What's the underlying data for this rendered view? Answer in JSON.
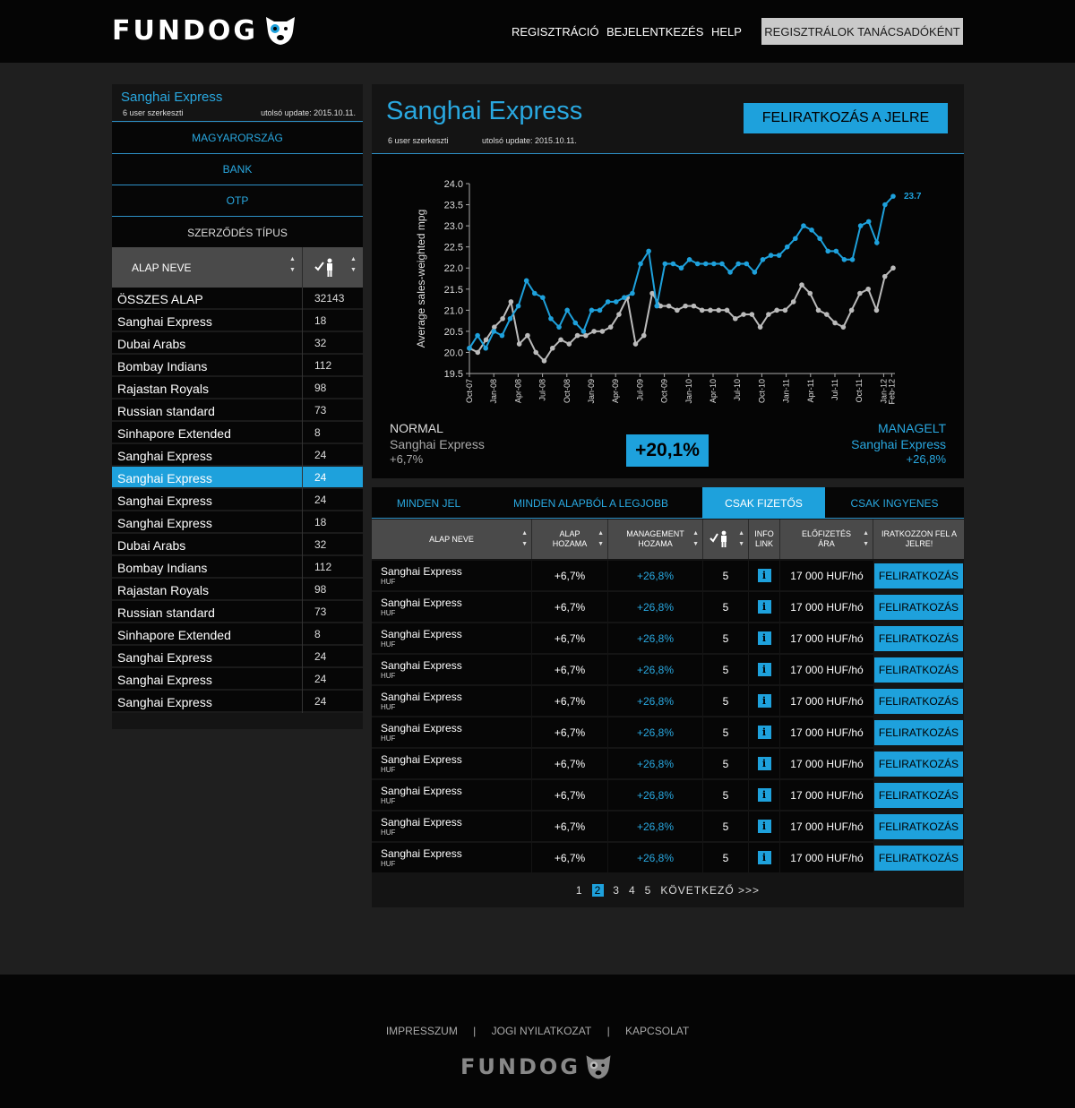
{
  "header": {
    "logo": "FUNDOG",
    "nav": [
      "REGISZTRÁCIÓ",
      "BEJELENTKEZÉS",
      "HELP"
    ],
    "advisor_button": "REGISZTRÁLOK TANÁCSADÓKÉNT"
  },
  "left": {
    "title": "Sanghai Express",
    "users": "6 user szerkeszti",
    "update": "utolsó update: 2015.10.11.",
    "filters": [
      "MAGYARORSZÁG",
      "BANK",
      "OTP",
      "SZERZŐDÉS TÍPUS"
    ],
    "col_name": "ALAP NEVE",
    "rows": [
      {
        "name": "ÖSSZES ALAP",
        "count": "32143"
      },
      {
        "name": "Sanghai Express",
        "count": "18"
      },
      {
        "name": "Dubai Arabs",
        "count": "32"
      },
      {
        "name": "Bombay Indians",
        "count": "112"
      },
      {
        "name": "Rajastan Royals",
        "count": "98"
      },
      {
        "name": "Russian standard",
        "count": "73"
      },
      {
        "name": "Sinhapore Extended",
        "count": "8"
      },
      {
        "name": "Sanghai Express",
        "count": "24"
      },
      {
        "name": "Sanghai Express",
        "count": "24"
      },
      {
        "name": "Sanghai Express",
        "count": "24"
      },
      {
        "name": "Sanghai Express",
        "count": "18"
      },
      {
        "name": "Dubai Arabs",
        "count": "32"
      },
      {
        "name": "Bombay Indians",
        "count": "112"
      },
      {
        "name": "Rajastan Royals",
        "count": "98"
      },
      {
        "name": "Russian standard",
        "count": "73"
      },
      {
        "name": "Sinhapore Extended",
        "count": "8"
      },
      {
        "name": "Sanghai Express",
        "count": "24"
      },
      {
        "name": "Sanghai Express",
        "count": "24"
      },
      {
        "name": "Sanghai Express",
        "count": "24"
      }
    ],
    "active_row": 8
  },
  "detail": {
    "title": "Sanghai Express",
    "users": "6 user szerkeszti",
    "update": "utolsó update: 2015.10.11.",
    "subscribe": "FELIRATKOZÁS A JELRE",
    "normal_label": "NORMAL",
    "normal_name": "Sanghai Express",
    "normal_value": "+6,7%",
    "diff": "+20,1%",
    "managed_label": "MANAGELT",
    "managed_name": "Sanghai Express",
    "managed_value": "+26,8%"
  },
  "chart_data": {
    "type": "line",
    "ylabel": "Average sales-weighted mpg",
    "ylim": [
      19.5,
      24.0
    ],
    "yticks": [
      "19.5",
      "20.0",
      "20.5",
      "21.0",
      "21.5",
      "22.0",
      "22.5",
      "23.0",
      "23.5",
      "24.0"
    ],
    "xticks": [
      "Oct-07",
      "Jan-08",
      "Apr-08",
      "Jul-08",
      "Oct-08",
      "Jan-09",
      "Apr-09",
      "Jul-09",
      "Oct-09",
      "Jan-10",
      "Apr-10",
      "Jul-10",
      "Oct-10",
      "Jan-11",
      "Apr-11",
      "Jul-11",
      "Oct-11",
      "Jan-12",
      "Feb-12"
    ],
    "end_label": "23.7",
    "colors": {
      "managed": "#1ea1dc",
      "normal": "#bbbbbb"
    },
    "series": [
      {
        "values": [
          20.1,
          20.4,
          20.1,
          20.5,
          20.4,
          20.8,
          21.1,
          21.7,
          21.4,
          21.3,
          20.8,
          20.6,
          21.0,
          20.7,
          20.5,
          21.0,
          21.0,
          21.2,
          21.2,
          21.3,
          21.4,
          22.1,
          22.4,
          21.1,
          22.1,
          22.1,
          22.0,
          22.2,
          22.1,
          22.1,
          22.1,
          22.1,
          21.9,
          22.1,
          22.1,
          21.9,
          22.2,
          22.3,
          22.3,
          22.5,
          22.7,
          23.0,
          22.9,
          22.7,
          22.4,
          22.4,
          22.2,
          22.2,
          23.0,
          23.1,
          22.6,
          23.5,
          23.7
        ]
      },
      {
        "values": [
          20.1,
          20.0,
          20.3,
          20.6,
          20.8,
          21.2,
          20.2,
          20.4,
          20.0,
          19.8,
          20.1,
          20.3,
          20.2,
          20.4,
          20.4,
          20.5,
          20.5,
          20.6,
          20.9,
          21.3,
          20.2,
          20.4,
          21.4,
          21.1,
          21.1,
          21.0,
          21.1,
          21.1,
          21.0,
          21.0,
          21.0,
          21.0,
          20.8,
          20.9,
          20.9,
          20.6,
          20.9,
          21.0,
          21.0,
          21.2,
          21.6,
          21.4,
          21.0,
          20.9,
          20.7,
          20.6,
          21.0,
          21.4,
          21.5,
          21.0,
          21.8,
          22.0
        ]
      }
    ]
  },
  "tabs": [
    "MINDEN JEL",
    "MINDEN ALAPBÓL A LEGJOBB",
    "CSAK FIZETŐS",
    "CSAK INGYENES"
  ],
  "active_tab": 2,
  "table": {
    "headers": [
      "ALAP NEVE",
      "ALAP HOZAMA",
      "MANAGEMENT HOZAMA",
      "",
      "INFO LINK",
      "ELŐFIZETÉS ÁRA",
      "IRATKOZZON FEL A JELRE!"
    ],
    "rows": [
      {
        "name": "Sanghai Express",
        "currency": "HUF",
        "base": "+6,7%",
        "mgmt": "+26,8%",
        "users": "5",
        "price": "17 000 HUF/hó",
        "button": "FELIRATKOZÁS"
      },
      {
        "name": "Sanghai Express",
        "currency": "HUF",
        "base": "+6,7%",
        "mgmt": "+26,8%",
        "users": "5",
        "price": "17 000 HUF/hó",
        "button": "FELIRATKOZÁS"
      },
      {
        "name": "Sanghai Express",
        "currency": "HUF",
        "base": "+6,7%",
        "mgmt": "+26,8%",
        "users": "5",
        "price": "17 000 HUF/hó",
        "button": "FELIRATKOZÁS"
      },
      {
        "name": "Sanghai Express",
        "currency": "HUF",
        "base": "+6,7%",
        "mgmt": "+26,8%",
        "users": "5",
        "price": "17 000 HUF/hó",
        "button": "FELIRATKOZÁS"
      },
      {
        "name": "Sanghai Express",
        "currency": "HUF",
        "base": "+6,7%",
        "mgmt": "+26,8%",
        "users": "5",
        "price": "17 000 HUF/hó",
        "button": "FELIRATKOZÁS"
      },
      {
        "name": "Sanghai Express",
        "currency": "HUF",
        "base": "+6,7%",
        "mgmt": "+26,8%",
        "users": "5",
        "price": "17 000 HUF/hó",
        "button": "FELIRATKOZÁS"
      },
      {
        "name": "Sanghai Express",
        "currency": "HUF",
        "base": "+6,7%",
        "mgmt": "+26,8%",
        "users": "5",
        "price": "17 000 HUF/hó",
        "button": "FELIRATKOZÁS"
      },
      {
        "name": "Sanghai Express",
        "currency": "HUF",
        "base": "+6,7%",
        "mgmt": "+26,8%",
        "users": "5",
        "price": "17 000 HUF/hó",
        "button": "FELIRATKOZÁS"
      },
      {
        "name": "Sanghai Express",
        "currency": "HUF",
        "base": "+6,7%",
        "mgmt": "+26,8%",
        "users": "5",
        "price": "17 000 HUF/hó",
        "button": "FELIRATKOZÁS"
      },
      {
        "name": "Sanghai Express",
        "currency": "HUF",
        "base": "+6,7%",
        "mgmt": "+26,8%",
        "users": "5",
        "price": "17 000 HUF/hó",
        "button": "FELIRATKOZÁS"
      }
    ]
  },
  "pager": {
    "pages": [
      "1",
      "2",
      "3",
      "4",
      "5"
    ],
    "current": "2",
    "next": "KÖVETKEZŐ >>>"
  },
  "footer": {
    "links": [
      "IMPRESSZUM",
      "JOGI NYILATKOZAT",
      "KAPCSOLAT"
    ],
    "separator": "|",
    "logo": "FUNDOG"
  }
}
